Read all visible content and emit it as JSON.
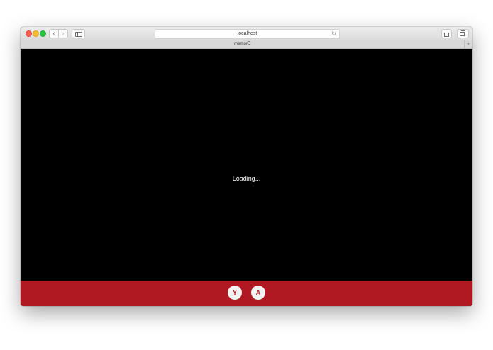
{
  "browser": {
    "address": "localhost",
    "tab_title": "memorE",
    "new_tab_label": "+",
    "back_glyph": "‹",
    "forward_glyph": "›",
    "reload_glyph": "↻"
  },
  "main": {
    "status": "Loading..."
  },
  "controls": {
    "buttons": [
      {
        "label": "Y"
      },
      {
        "label": "A"
      }
    ],
    "background_color": "#b01921"
  },
  "icons": [
    "sidebar-icon",
    "share-icon",
    "tabs-overview-icon",
    "reload-icon"
  ]
}
